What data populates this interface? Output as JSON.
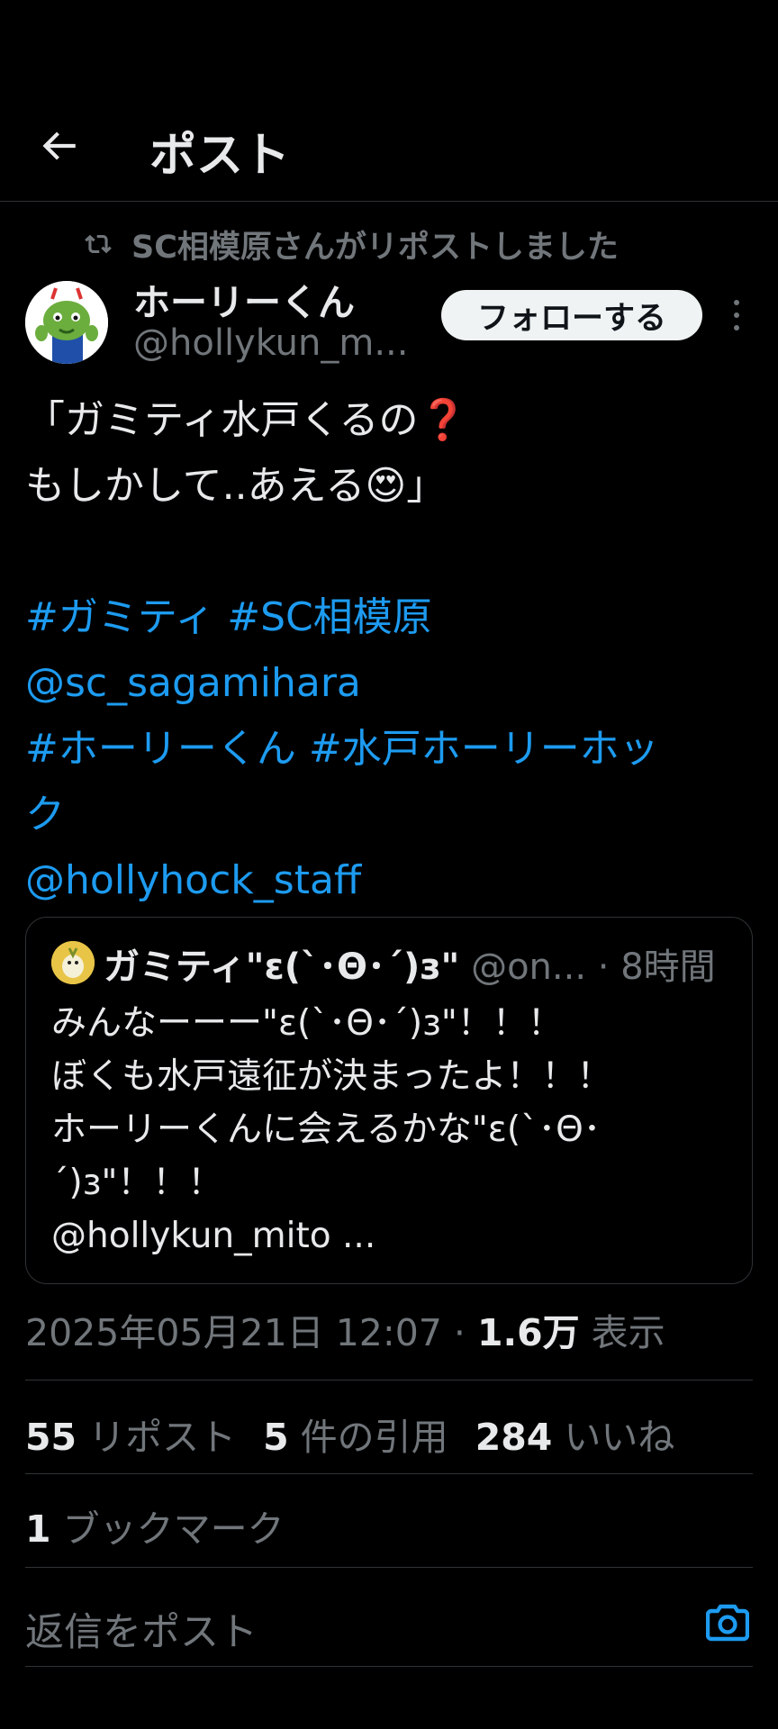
{
  "header": {
    "title": "ポスト"
  },
  "repost_note": "SC相模原さんがリポストしました",
  "author": {
    "name": "ホーリーくん",
    "handle": "@hollykun_m..."
  },
  "follow_label": "フォローする",
  "post": {
    "lines": [
      "「ガミティ水戸くるの❓",
      "もしかして..あえる😍」"
    ],
    "tag_line1_a": "#ガミティ",
    "tag_line1_b": "#SC相模原",
    "mention1": "@sc_sagamihara",
    "tag_line3_a": "#ホーリーくん",
    "tag_line3_b": "#水戸ホーリーホッ",
    "tag_line4": "ク",
    "mention2": "@hollyhock_staff"
  },
  "quote": {
    "name": "ガミティ\"ε(`･Θ･´)з\"",
    "handle": "@on...",
    "time": " · 8時間",
    "lines": [
      "みんなーーー\"ε(`･Θ･´)з\"！！！",
      "ぼくも水戸遠征が決まったよ！！！",
      "ホーリーくんに会えるかな\"ε(`･Θ･",
      "´)з\"！！！",
      "@hollykun_mito ..."
    ]
  },
  "timestamp": "2025年05月21日 12:07 · ",
  "views_count": "1.6万",
  "views_label": " 表示",
  "stats": {
    "reposts_num": "55",
    "reposts_label": " リポスト",
    "quotes_num": "5",
    "quotes_label": " 件の引用",
    "likes_num": "284",
    "likes_label": " いいね"
  },
  "bookmarks": {
    "num": "1",
    "label": " ブックマーク"
  },
  "reply": {
    "placeholder": "返信をポスト"
  },
  "colors": {
    "link": "#1d9bf0",
    "muted": "#71767b",
    "text": "#e7e9ea",
    "background": "#000000"
  },
  "icons": [
    "back-arrow-icon",
    "repost-icon",
    "more-icon",
    "camera-icon"
  ]
}
